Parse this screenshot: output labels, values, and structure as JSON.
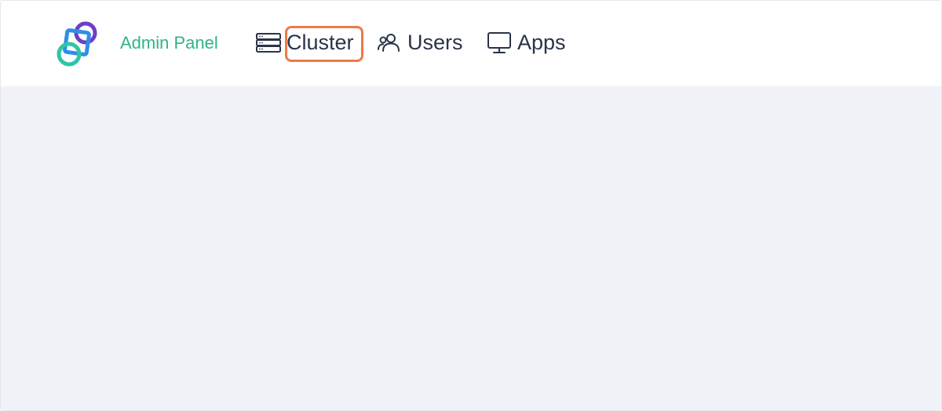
{
  "brand": {
    "title": "Admin Panel",
    "logo_icon": "linked-rings-logo"
  },
  "nav": {
    "items": [
      {
        "label": "Cluster",
        "icon": "server-stack-icon",
        "highlighted": true
      },
      {
        "label": "Users",
        "icon": "users-icon",
        "highlighted": false
      },
      {
        "label": "Apps",
        "icon": "monitor-icon",
        "highlighted": false
      }
    ]
  },
  "colors": {
    "brand_text": "#2fb583",
    "nav_text": "#2a3448",
    "highlight_border": "#ee7a45",
    "page_background": "#f0f2f7",
    "navbar_background": "#ffffff",
    "logo_purple": "#6c3fc5",
    "logo_blue": "#2f8ee6",
    "logo_teal": "#2fc5a8"
  }
}
